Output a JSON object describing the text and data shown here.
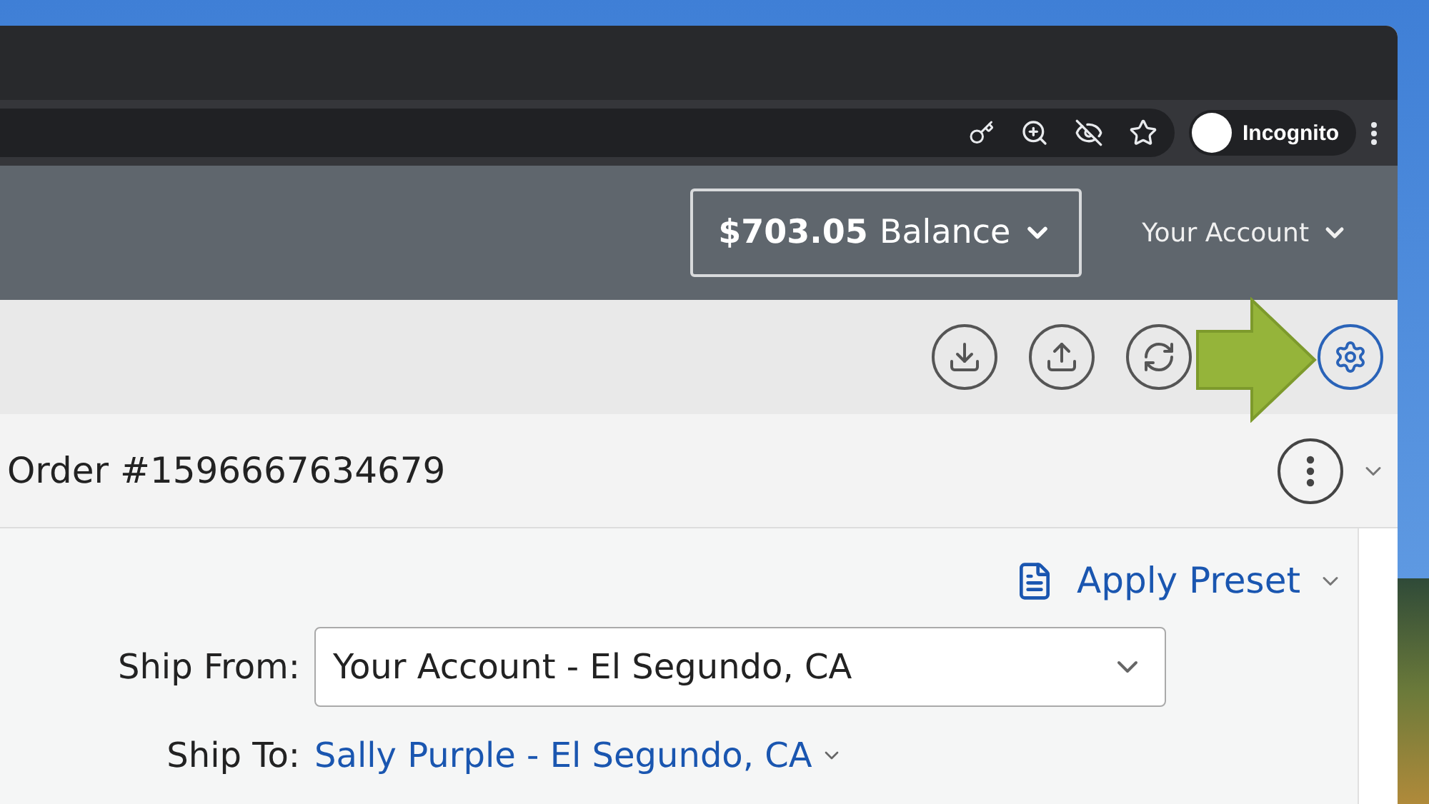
{
  "browser": {
    "profile": "Incognito"
  },
  "header": {
    "balance_amount": "$703.05",
    "balance_label": "Balance",
    "account": "Your Account"
  },
  "order": {
    "title": "Order #1596667634679"
  },
  "form": {
    "preset": "Apply Preset",
    "ship_from": {
      "label": "Ship From:",
      "value": "Your Account - El Segundo, CA"
    },
    "ship_to": {
      "label": "Ship To:",
      "value": "Sally Purple - El Segundo, CA"
    }
  }
}
